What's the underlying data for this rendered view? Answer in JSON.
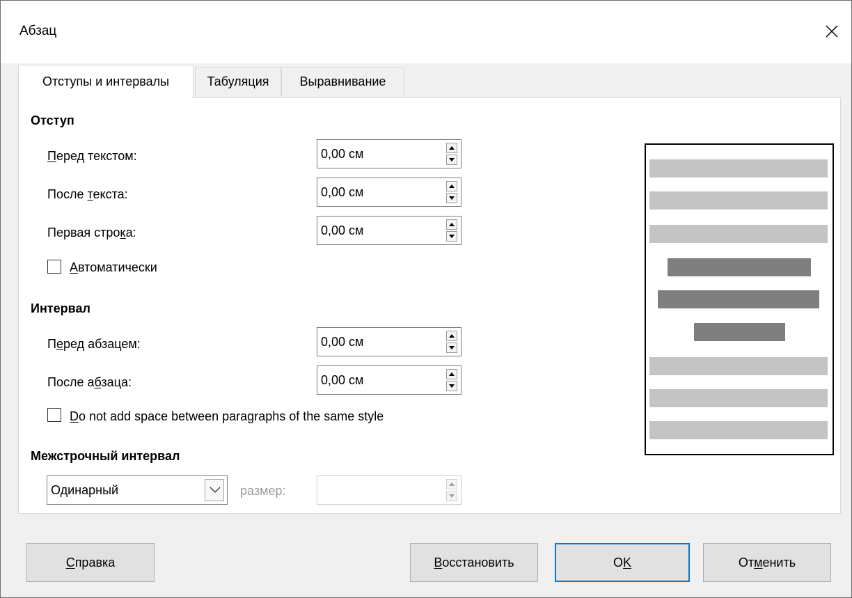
{
  "window": {
    "title": "Абзац"
  },
  "tabs": [
    {
      "label": "Отступы и интервалы"
    },
    {
      "label": "Табуляция"
    },
    {
      "label": "Выравнивание"
    }
  ],
  "indent": {
    "section_title": "Отступ",
    "before_text": {
      "label_pre": "",
      "label_u": "П",
      "label_post": "еред текстом:",
      "value": "0,00 см"
    },
    "after_text": {
      "label_pre": "После ",
      "label_u": "т",
      "label_post": "екста:",
      "value": "0,00 см"
    },
    "first_line": {
      "label_pre": "Первая стро",
      "label_u": "к",
      "label_post": "а:",
      "value": "0,00 см"
    },
    "auto_checkbox": {
      "label_pre": "",
      "label_u": "А",
      "label_post": "втоматически",
      "checked": false
    }
  },
  "spacing": {
    "section_title": "Интервал",
    "before_paragraph": {
      "label_pre": "П",
      "label_u": "е",
      "label_post": "ред абзацем:",
      "value": "0,00 см"
    },
    "after_paragraph": {
      "label_pre": "После а",
      "label_u": "б",
      "label_post": "заца:",
      "value": "0,00 см"
    },
    "no_space_checkbox": {
      "label_pre": "",
      "label_u": "D",
      "label_post": "o not add space between paragraphs of the same style",
      "checked": false
    }
  },
  "line_spacing": {
    "section_title": "Межстрочный интервал",
    "selected": "Одинарный",
    "size_label": "размер:",
    "size_value": ""
  },
  "preview": {
    "colors": {
      "light": "#c4c4c4",
      "dark": "#7f7f7f"
    }
  },
  "buttons": {
    "help": {
      "label_pre": "",
      "label_u": "С",
      "label_post": "правка"
    },
    "reset": {
      "label_pre": "",
      "label_u": "В",
      "label_post": "осстановить"
    },
    "ok": {
      "label_pre": "O",
      "label_u": "K",
      "label_post": ""
    },
    "cancel": {
      "label_pre": "От",
      "label_u": "м",
      "label_post": "енить"
    }
  },
  "colors": {
    "accent": "#0078d7"
  }
}
